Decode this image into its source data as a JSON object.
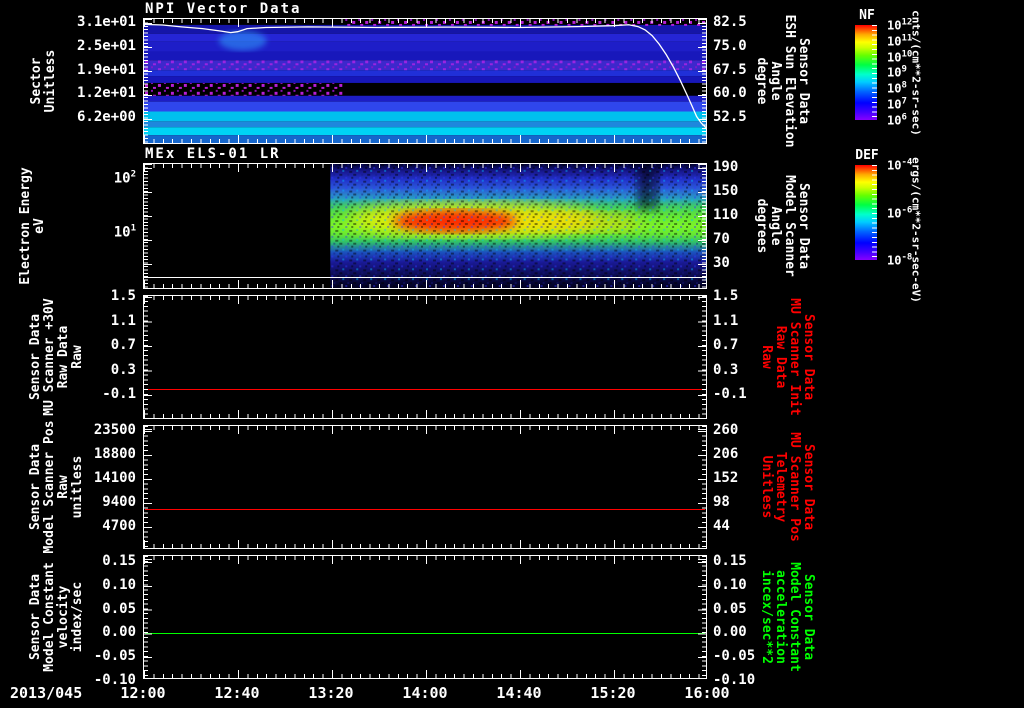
{
  "panels": [
    {
      "title": "NPI Vector Data",
      "left_label_lines": [
        "Sector",
        "Unitless"
      ],
      "left_ticks": [
        "3.1e+01",
        "2.5e+01",
        "1.9e+01",
        "1.2e+01",
        "6.2e+00"
      ],
      "right_ticks": [
        "82.5",
        "75.0",
        "67.5",
        "60.0",
        "52.5"
      ],
      "right_label_lines": [
        "Sensor Data",
        "ESH Sun Elevation",
        "Angle",
        "degree"
      ],
      "right_label_color": "#ffffff"
    },
    {
      "title": "MEx ELS-01 LR",
      "left_label_lines": [
        "Electron Energy",
        "eV"
      ],
      "left_tick_exponents": [
        2,
        1
      ],
      "right_ticks": [
        "190",
        "150",
        "110",
        "70",
        "30"
      ],
      "right_label_lines": [
        "Sensor Data",
        "Model Scanner",
        "Angle",
        "degrees"
      ],
      "right_label_color": "#ffffff"
    },
    {
      "left_label_lines": [
        "Sensor Data",
        "MU Scanner +30V",
        "Raw Data",
        "Raw"
      ],
      "left_ticks": [
        "1.5",
        "1.1",
        "0.7",
        "0.3",
        "-0.1"
      ],
      "right_ticks": [
        "1.5",
        "1.1",
        "0.7",
        "0.3",
        "-0.1"
      ],
      "right_label_lines": [
        "Sensor Data",
        "MU Scanner Init",
        "Raw Data",
        "Raw"
      ],
      "right_label_color": "#ff0000"
    },
    {
      "left_label_lines": [
        "Sensor Data",
        "Model Scanner Pos",
        "Raw",
        "unitless"
      ],
      "left_ticks": [
        "23500",
        "18800",
        "14100",
        "9400",
        "4700"
      ],
      "right_ticks": [
        "260",
        "206",
        "152",
        "98",
        "44"
      ],
      "right_label_lines": [
        "Sensor Data",
        "MU Scanner Pos",
        "Telemetry",
        "Unitless"
      ],
      "right_label_color": "#ff0000"
    },
    {
      "left_label_lines": [
        "Sensor Data",
        "Model Constant",
        "velocity",
        "index/sec"
      ],
      "left_ticks": [
        "0.15",
        "0.10",
        "0.05",
        "0.00",
        "-0.05",
        "-0.10"
      ],
      "right_ticks": [
        "0.15",
        "0.10",
        "0.05",
        "0.00",
        "-0.05",
        "-0.10"
      ],
      "right_label_lines": [
        "Sensor Data",
        "Model Constant",
        "acceleration",
        "incex/sec**2"
      ],
      "right_label_color": "#00ff00"
    }
  ],
  "colorbars": [
    {
      "name": "NF",
      "tick_exponents": [
        12,
        11,
        10,
        9,
        8,
        7,
        6
      ],
      "units": "cnts/(cm**2-sr-sec)"
    },
    {
      "name": "DEF",
      "tick_exponents": [
        -4,
        -6,
        -8
      ],
      "units": "ergs/(cm**2-sr-sec-eV)"
    }
  ],
  "x_axis": {
    "date_label": "2013/045",
    "time_ticks": [
      "12:00",
      "12:40",
      "13:20",
      "14:00",
      "14:40",
      "15:20",
      "16:00"
    ]
  },
  "chart_data": [
    {
      "type": "heatmap",
      "title": "NPI Vector Data",
      "x_axis": {
        "start": "2013/045 12:00",
        "end": "16:00",
        "tick_interval_min": 40
      },
      "y_axis": {
        "label": "Sector Unitless",
        "ticks": [
          31,
          25,
          19,
          12,
          6.2
        ],
        "range": [
          0,
          32
        ]
      },
      "z_axis": {
        "name": "NF",
        "units": "cnts/(cm**2-sr-sec)",
        "log10_range": [
          6,
          12
        ]
      },
      "bands": [
        {
          "sector_range": [
            30,
            32
          ],
          "level": "black, sporadic purple counts after 13:30"
        },
        {
          "sector_range": [
            23,
            30
          ],
          "level": "blue ~1e7"
        },
        {
          "sector_range": [
            17,
            23
          ],
          "level": "noisy purple-blue ~3e6"
        },
        {
          "sector_range": [
            13,
            17
          ],
          "level": "blue ~1e7"
        },
        {
          "sector_range": [
            10,
            13
          ],
          "level": "black, purple speckles before 13:20"
        },
        {
          "sector_range": [
            5,
            10
          ],
          "level": "blue-cyan ~3e7"
        },
        {
          "sector_range": [
            0,
            5
          ],
          "level": "cyan ~1e8"
        }
      ],
      "overlay": {
        "name": "ESH Sun Elevation Angle (degree)",
        "right_ticks": [
          82.5,
          75.0,
          67.5,
          60.0,
          52.5
        ],
        "points_min_deg": [
          [
            0,
            82
          ],
          [
            8,
            81.8
          ],
          [
            16,
            81.2
          ],
          [
            25,
            80.6
          ],
          [
            33,
            79.8
          ],
          [
            37,
            79.3
          ],
          [
            40,
            79.6
          ],
          [
            44,
            80.6
          ],
          [
            52,
            81
          ],
          [
            70,
            81.2
          ],
          [
            100,
            81
          ],
          [
            130,
            81.1
          ],
          [
            160,
            81
          ],
          [
            185,
            81.3
          ],
          [
            200,
            81.6
          ],
          [
            207,
            81.9
          ],
          [
            211,
            81.3
          ],
          [
            214,
            80.2
          ],
          [
            217,
            78.3
          ],
          [
            220,
            75.5
          ],
          [
            223,
            72
          ],
          [
            226,
            68
          ],
          [
            229,
            63.5
          ],
          [
            232,
            58.5
          ],
          [
            234,
            55
          ],
          [
            236,
            51.5
          ],
          [
            238,
            49.3
          ],
          [
            240,
            47.8
          ]
        ]
      }
    },
    {
      "type": "heatmap",
      "title": "MEx ELS-01 LR",
      "y_axis": {
        "label": "Electron Energy eV",
        "scale": "log",
        "ticks": [
          100,
          10
        ]
      },
      "z_axis": {
        "name": "DEF",
        "units": "ergs/(cm**2-sr-sec-eV)",
        "log10_range": [
          -8,
          -4
        ]
      },
      "no_data_before": "13:18",
      "features": [
        {
          "desc": "broad enhancement 7-40 eV, green ~1e-6",
          "from": "13:20",
          "to": "16:00"
        },
        {
          "desc": "intense red core 10-25 eV ~1e-4",
          "from": "14:00",
          "to": "14:40"
        },
        {
          "desc": "yellow decaying tail 10-20 eV ~1e-5",
          "from": "14:40",
          "to": "15:20"
        },
        {
          "desc": "blue noise background above/below band",
          "from": "13:20",
          "to": "16:00"
        }
      ]
    },
    {
      "type": "line",
      "title": "MU Scanner +30V Raw Data Raw",
      "color": "#ff0000",
      "yticks": [
        1.5,
        1.1,
        0.7,
        0.3,
        -0.1
      ],
      "constant_value": 0.0
    },
    {
      "type": "line",
      "title": "Model Scanner Pos Raw unitless",
      "color": "#ff0000",
      "yticks": [
        23500,
        18800,
        14100,
        9400,
        4700
      ],
      "constant_value": 8200
    },
    {
      "type": "line",
      "title": "Model Constant velocity index/sec",
      "color": "#00ff00",
      "yticks": [
        0.15,
        0.1,
        0.05,
        0.0,
        -0.05,
        -0.1
      ],
      "constant_value": 0.0
    }
  ]
}
